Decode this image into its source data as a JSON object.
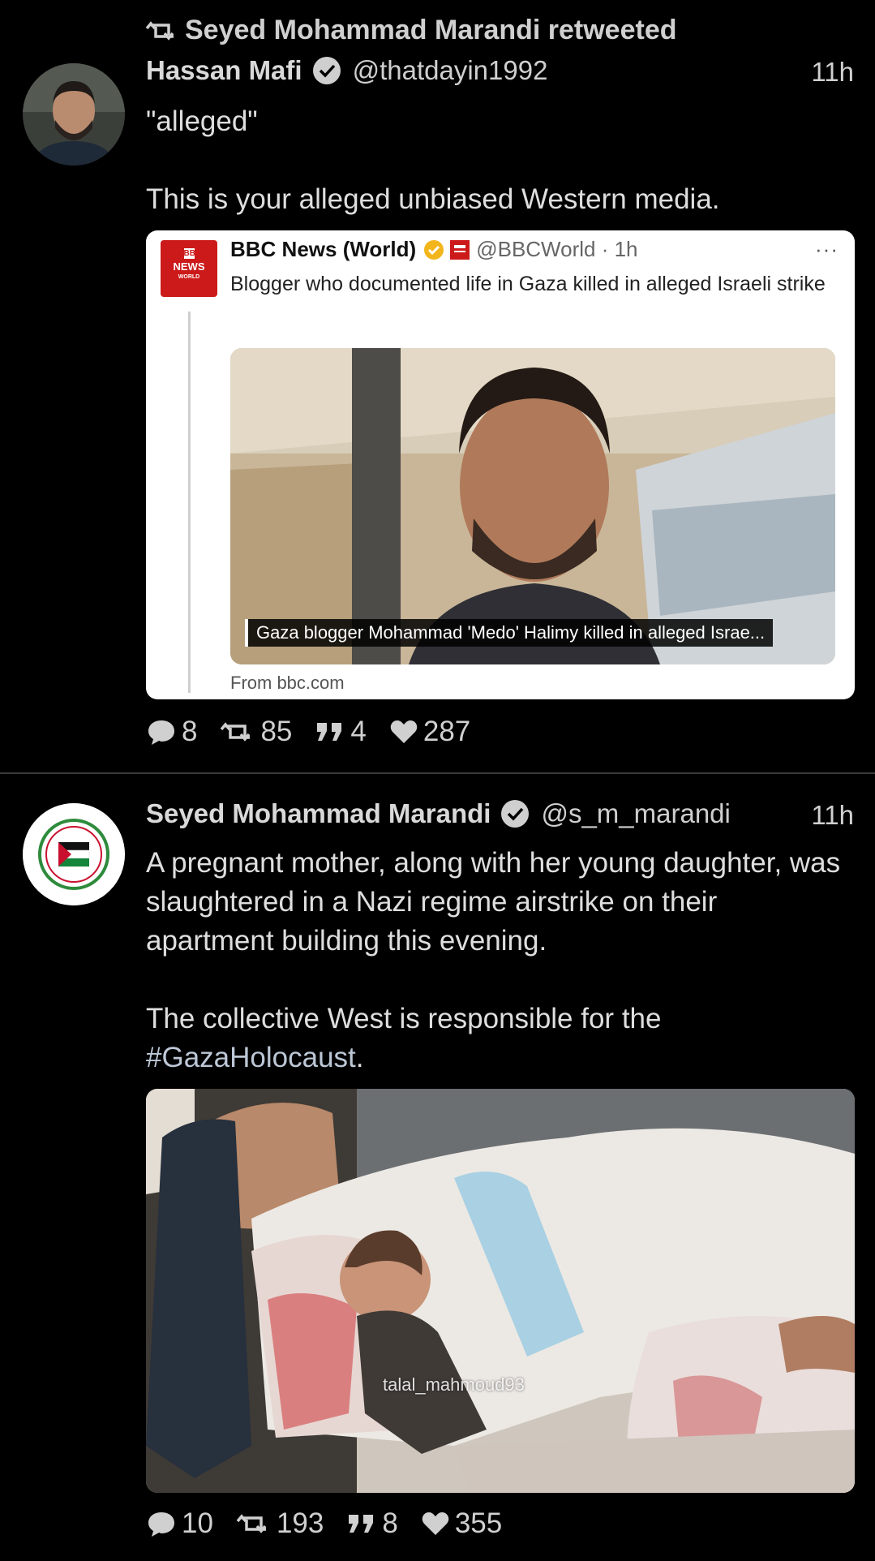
{
  "tweet1": {
    "retweet_label": "Seyed Mohammad Marandi retweeted",
    "author_name": "Hassan Mafi",
    "handle": "@thatdayin1992",
    "time": "11h",
    "text": "\"alleged\"\n\nThis is your alleged unbiased Western media.",
    "quote": {
      "logo_lines": [
        "BBC",
        "NEWS",
        "WORLD"
      ],
      "author_name": "BBC News (World)",
      "handle": "@BBCWorld · 1h",
      "menu": "···",
      "text": "Blogger who documented life in Gaza killed in alleged Israeli strike",
      "caption": "Gaza blogger Mohammad 'Medo' Halimy killed in alleged Israe...",
      "source": "From bbc.com"
    },
    "stats": {
      "replies": "8",
      "retweets": "85",
      "quotes": "4",
      "likes": "287"
    }
  },
  "tweet2": {
    "author_name": "Seyed Mohammad Marandi",
    "handle": "@s_m_marandi",
    "time": "11h",
    "text_main": "A pregnant mother, along with her young daughter, was slaughtered in a Nazi regime airstrike on their apartment building this evening.\n\nThe collective West is responsible for the ",
    "hashtag": "#GazaHolocaust",
    "text_end": ".",
    "media_watermark": "talal_mahmoud93",
    "stats": {
      "replies": "10",
      "retweets": "193",
      "quotes": "8",
      "likes": "355"
    }
  },
  "colors": {
    "background": "#000000",
    "text": "#d9d9d9",
    "hashtag": "#bcc7d6",
    "bbc_red": "#cc1a1a",
    "gold_check": "#f2b51c"
  },
  "icons": [
    "retweet-icon",
    "verified-badge-icon",
    "reply-icon",
    "quote-icon",
    "heart-icon",
    "more-icon"
  ]
}
